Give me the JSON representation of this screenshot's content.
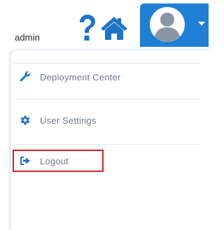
{
  "topbar": {
    "help_icon": "question-icon",
    "home_icon": "home-icon",
    "avatar_icon": "user-avatar-icon",
    "caret_icon": "caret-down-icon",
    "icon_color": "#1e73c8",
    "trigger_color": "#1e7fd4"
  },
  "menu": {
    "header": "admin",
    "items": [
      {
        "label": "Deployment Center",
        "icon": "wrench-icon",
        "icon_color": "#1e73c8"
      },
      {
        "label": "User Settings",
        "icon": "cog-icon",
        "icon_color": "#1e73c8"
      },
      {
        "label": "Logout",
        "icon": "sign-out-icon",
        "icon_color": "#1e73c8",
        "highlighted": true
      }
    ],
    "highlight_color": "#d9222a"
  }
}
